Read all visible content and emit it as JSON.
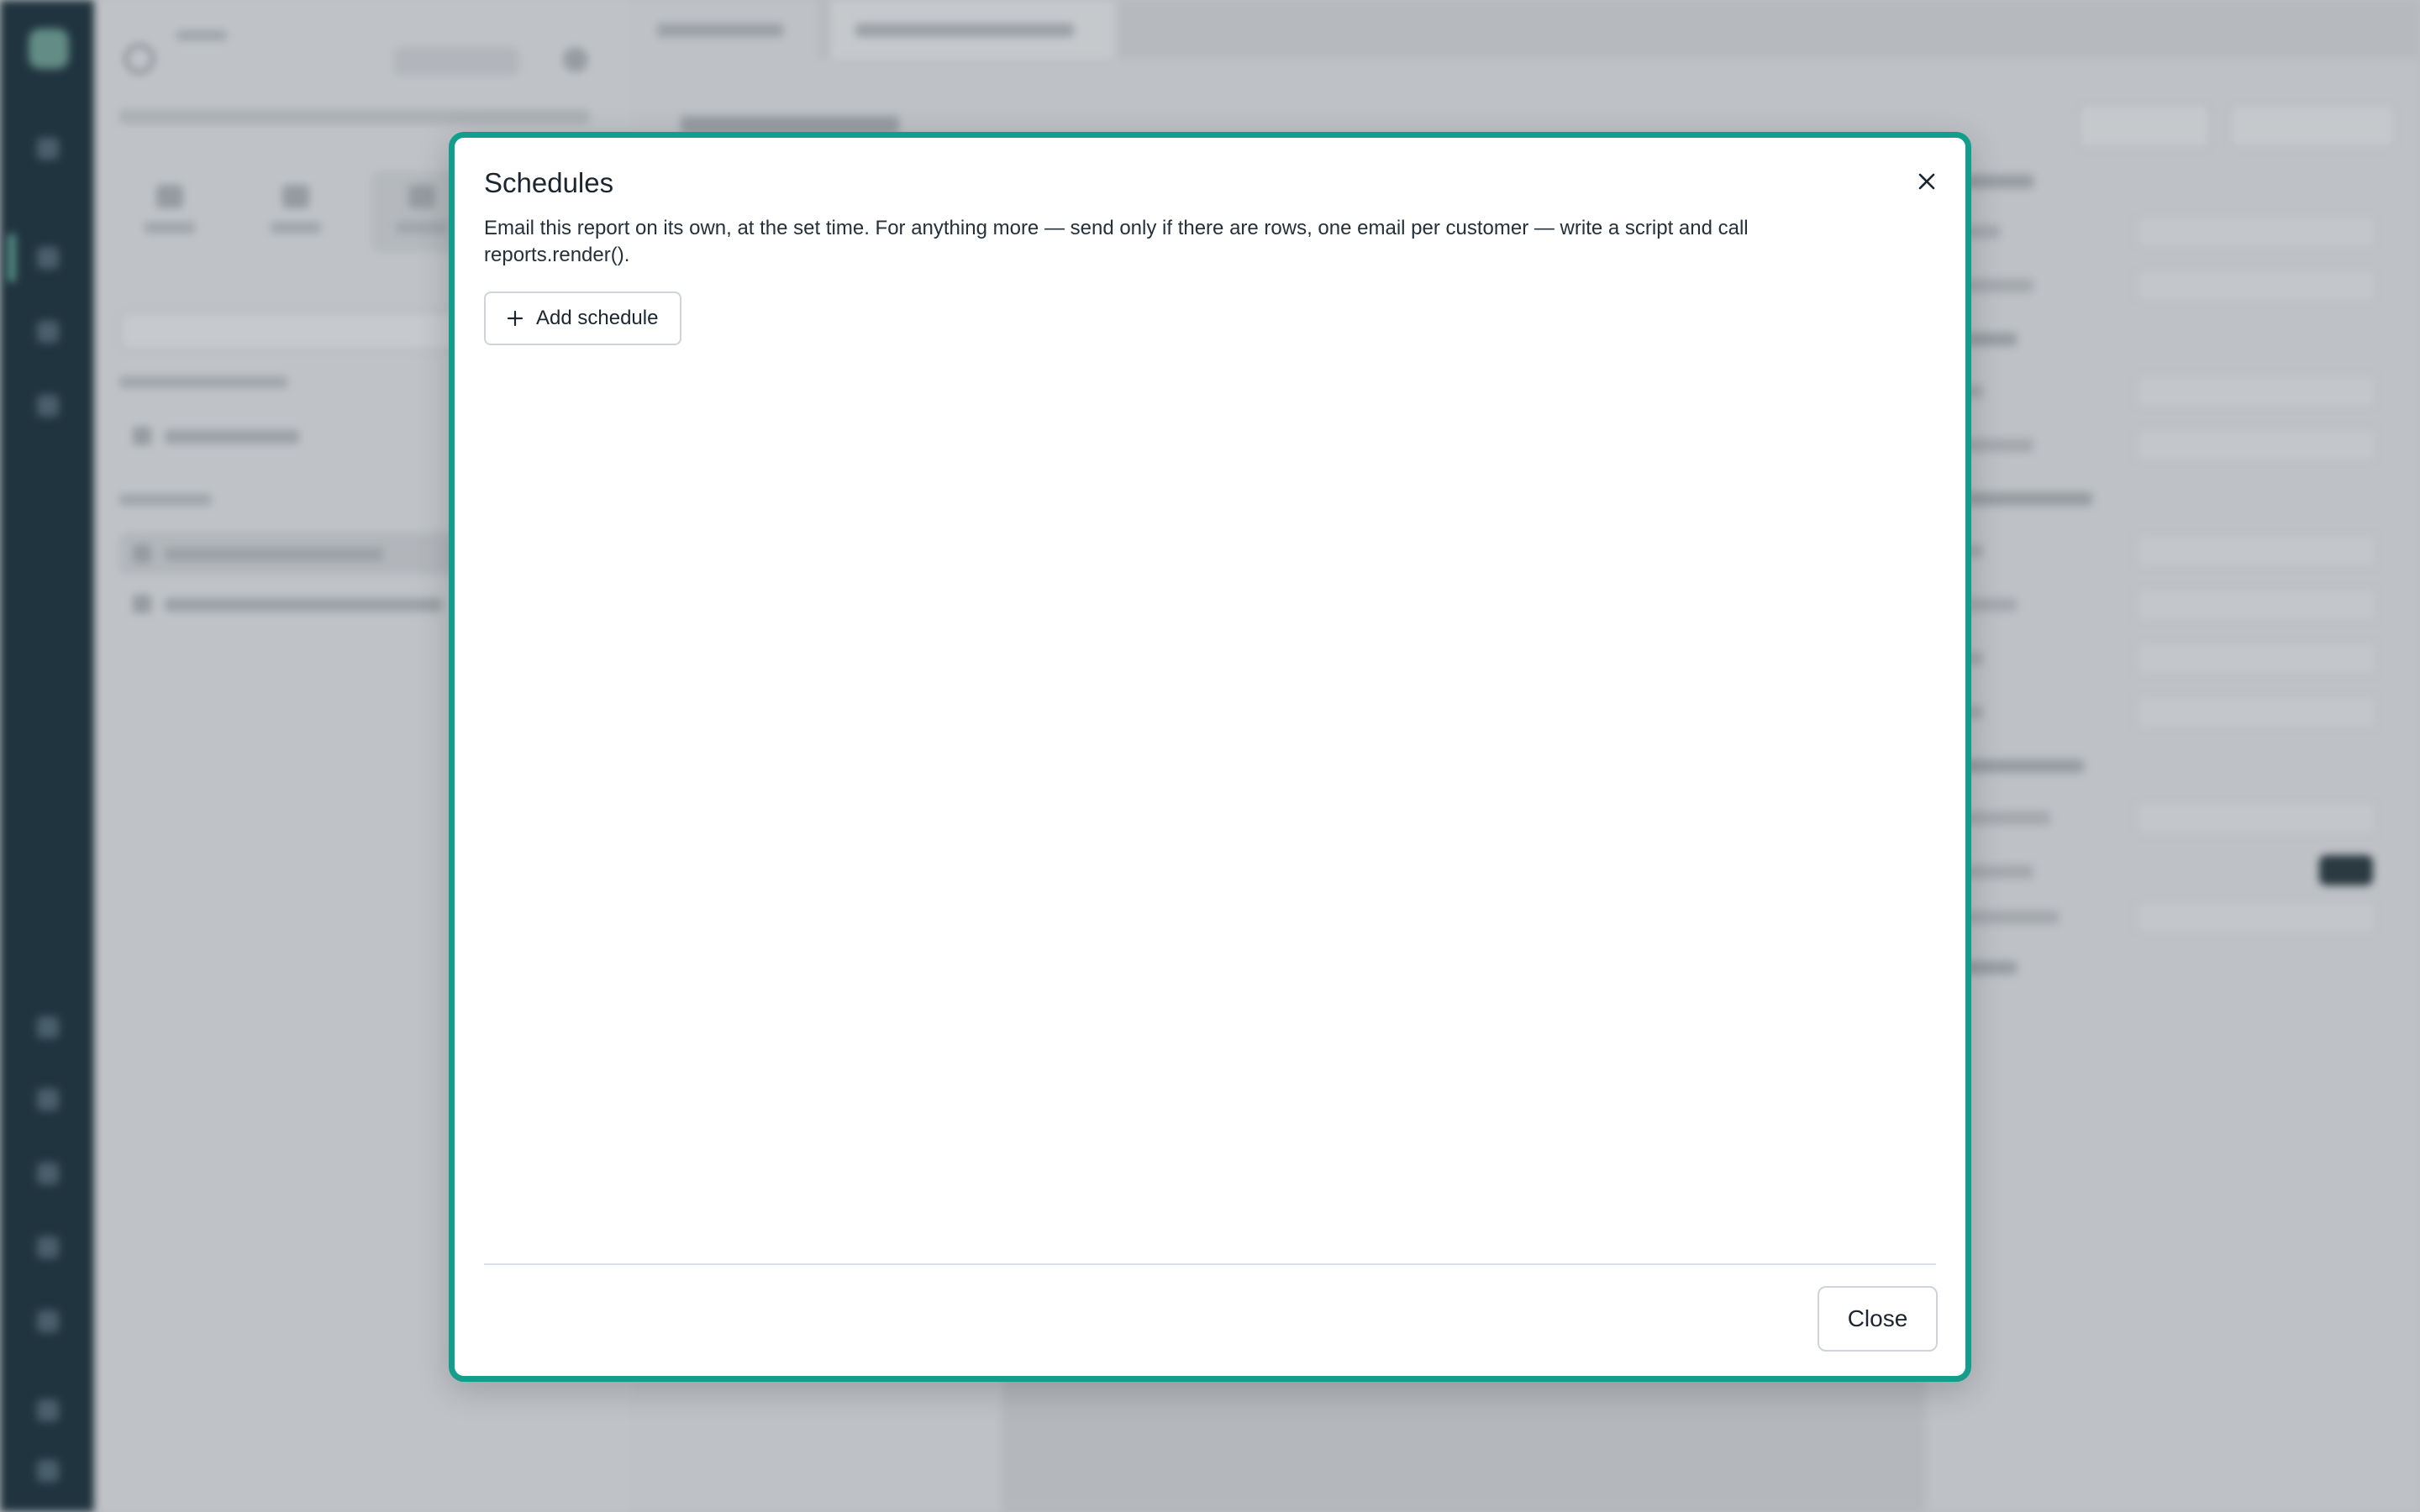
{
  "modal": {
    "title": "Schedules",
    "description": "Email this report on its own, at the set time. For anything more — send only if there are rows, one email per customer — write a script and call reports.render().",
    "add_schedule_label": "Add schedule",
    "close_label": "Close",
    "accent_color": "#139d8c"
  },
  "icons": {
    "close": "close-icon",
    "add": "plus-icon"
  }
}
